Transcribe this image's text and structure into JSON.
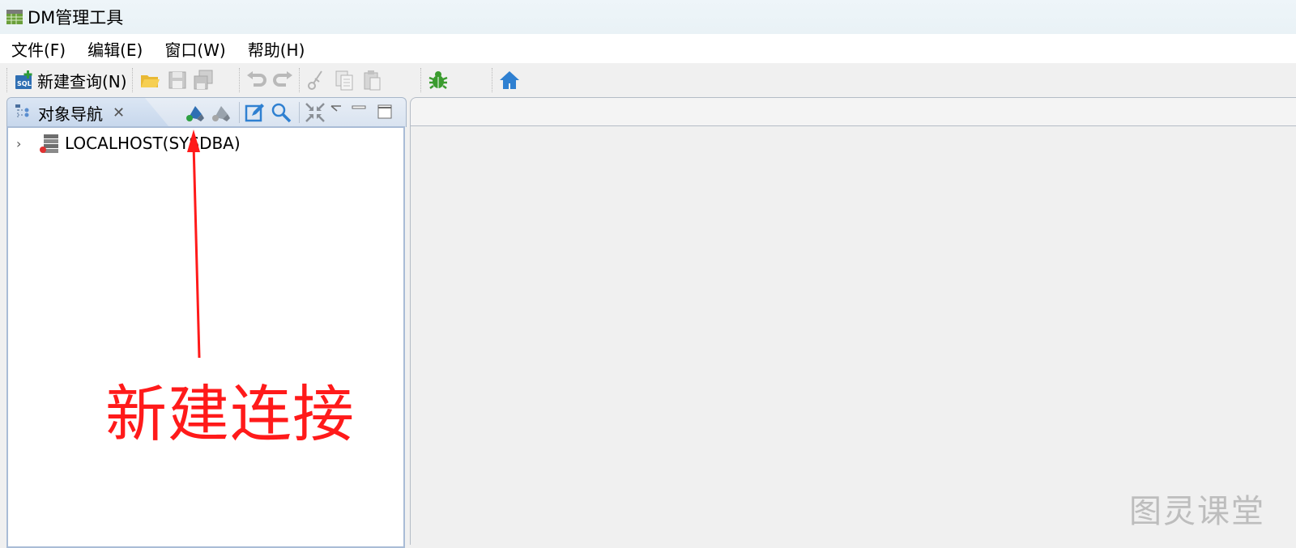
{
  "window": {
    "title": "DM管理工具",
    "icons": {
      "app": "table-icon"
    }
  },
  "menubar": {
    "items": [
      "文件(F)",
      "编辑(E)",
      "窗口(W)",
      "帮助(H)"
    ]
  },
  "toolbar": {
    "new_query_label": "新建查询(N)",
    "icons": [
      "sql-new-icon",
      "folder-open-icon",
      "save-icon",
      "save-all-icon",
      "undo-icon",
      "redo-icon",
      "cut-icon",
      "copy-icon",
      "paste-icon",
      "bug-icon",
      "home-icon"
    ]
  },
  "object_navigator": {
    "tab_label": "对象导航",
    "close_glyph": "✕",
    "tools": [
      "new-connection-icon",
      "disconnect-icon",
      "edit-icon",
      "search-icon",
      "collapse-all-icon",
      "view-menu-icon",
      "minimize-icon",
      "maximize-icon"
    ],
    "tree": [
      {
        "label": "LOCALHOST(SYSDBA)",
        "expand_glyph": "›",
        "icon": "database-icon"
      }
    ]
  },
  "annotation": {
    "text": "新建连接",
    "color": "#ff1a1a"
  },
  "watermark": "图灵课堂",
  "colors": {
    "titlebar_bg": "#eef5f9",
    "panel_border": "#a9bcd6",
    "accent_blue": "#2f80d1",
    "bug_green": "#3a9b2e"
  }
}
